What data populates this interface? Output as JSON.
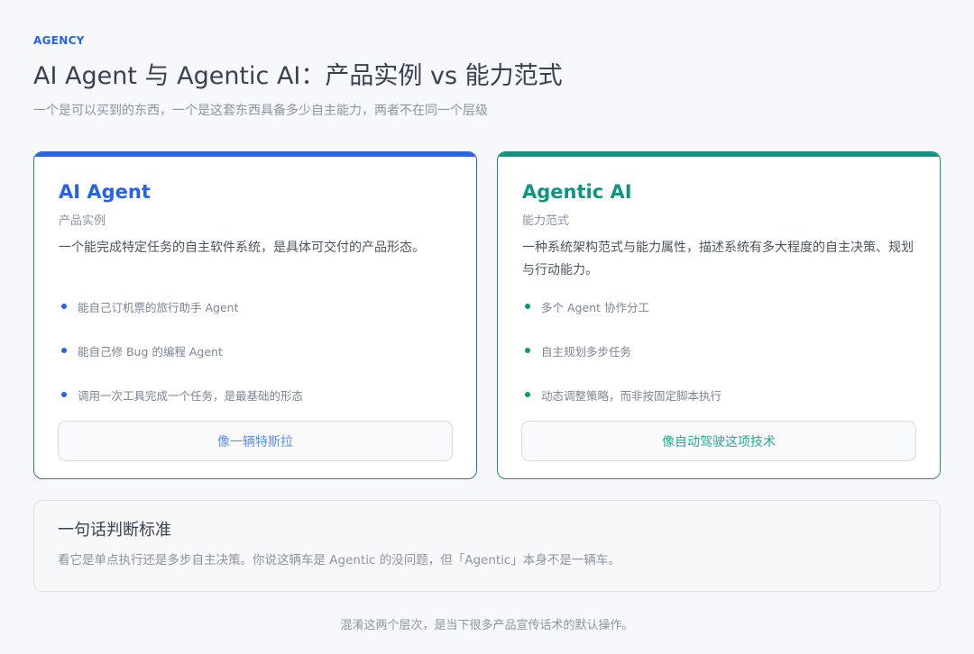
{
  "header": {
    "eyebrow": "AGENCY",
    "title": "AI Agent 与 Agentic AI：产品实例 vs 能力范式",
    "subtitle": "一个是可以买到的东西，一个是这套东西具备多少自主能力，两者不在同一个层级"
  },
  "cards": [
    {
      "title": "AI Agent",
      "kind": "产品实例",
      "description": "一个能完成特定任务的自主软件系统，是具体可交付的产品形态。",
      "bullets": [
        "能自己订机票的旅行助手 Agent",
        "能自己修 Bug 的编程 Agent",
        "调用一次工具完成一个任务，是最基础的形态"
      ],
      "analogy": "像一辆特斯拉",
      "accent": "#2563eb"
    },
    {
      "title": "Agentic AI",
      "kind": "能力范式",
      "description": "一种系统架构范式与能力属性，描述系统有多大程度的自主决策、规划与行动能力。",
      "bullets": [
        "多个 Agent 协作分工",
        "自主规划多步任务",
        "动态调整策略，而非按固定脚本执行"
      ],
      "analogy": "像自动驾驶这项技术",
      "accent": "#0f9480"
    }
  ],
  "summary": {
    "title": "一句话判断标准",
    "text": "看它是单点执行还是多步自主决策。你说这辆车是 Agentic 的没问题，但「Agentic」本身不是一辆车。"
  },
  "footer": "混淆这两个层次，是当下很多产品宣传话术的默认操作。"
}
